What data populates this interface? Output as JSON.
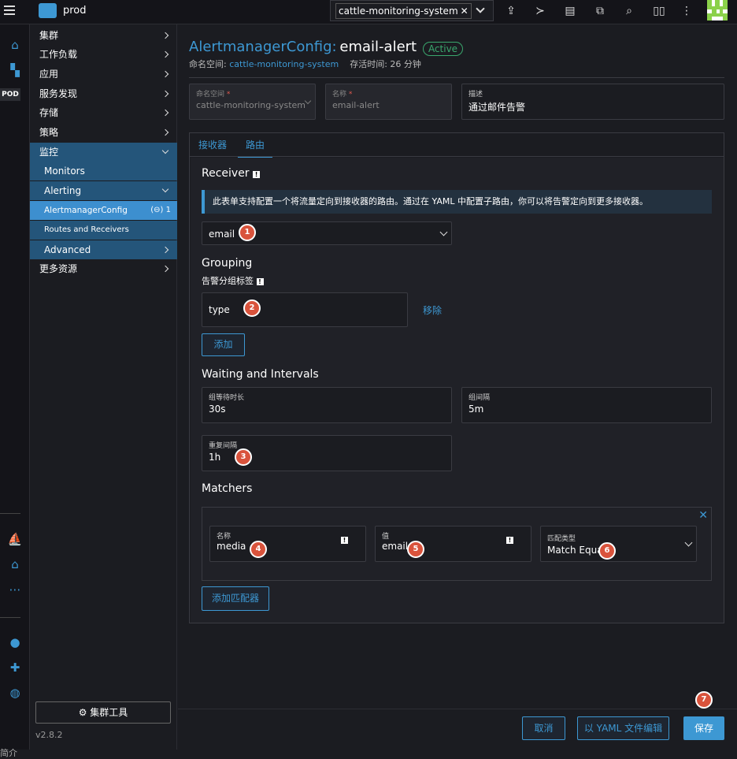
{
  "topbar": {
    "cluster_name": "prod",
    "namespace_chip": "cattle-monitoring-system",
    "chip_remove": "✕",
    "icons": [
      "upload-icon",
      "terminal-icon",
      "file-icon",
      "copy-icon",
      "search-icon",
      "book-icon",
      "more-icon"
    ]
  },
  "rail": {
    "pod_label": "POD",
    "bottom_text": "简介"
  },
  "sidenav": {
    "items": [
      {
        "label": "集群"
      },
      {
        "label": "工作负载"
      },
      {
        "label": "应用"
      },
      {
        "label": "服务发现"
      },
      {
        "label": "存储"
      },
      {
        "label": "策略"
      },
      {
        "label": "监控"
      },
      {
        "label": "Monitors"
      },
      {
        "label": "Alerting"
      },
      {
        "label": "AlertmanagerConfig",
        "count": "(⊖) 1"
      },
      {
        "label": "Routes and Receivers"
      },
      {
        "label": "Advanced"
      },
      {
        "label": "更多资源"
      }
    ],
    "tools_button": "⚙ 集群工具",
    "version": "v2.8.2"
  },
  "header": {
    "title_prefix": "AlertmanagerConfig:",
    "title_name": "email-alert",
    "status": "Active",
    "ns_label": "命名空间:",
    "ns_value": "cattle-monitoring-system",
    "age_label": "存活时间: 26 分钟"
  },
  "form": {
    "namespace": {
      "label": "命名空间",
      "required": "*",
      "value": "cattle-monitoring-system"
    },
    "name": {
      "label": "名称",
      "required": "*",
      "placeholder": "email-alert"
    },
    "description": {
      "label": "描述",
      "value": "通过邮件告警"
    }
  },
  "tabs": [
    {
      "label": "接收器"
    },
    {
      "label": "路由"
    }
  ],
  "route": {
    "receiver_heading": "Receiver",
    "info_text": "此表单支持配置一个将流量定向到接收器的路由。通过在 YAML 中配置子路由，你可以将告警定向到更多接收器。",
    "receiver_value": "email",
    "grouping_heading": "Grouping",
    "group_label_title": "告警分组标签",
    "group_value": "type",
    "remove_link": "移除",
    "add_button": "添加",
    "waiting_heading": "Waiting and Intervals",
    "group_wait": {
      "label": "组等待时长",
      "value": "30s"
    },
    "group_interval": {
      "label": "组间隔",
      "value": "5m"
    },
    "repeat_interval": {
      "label": "重复间隔",
      "value": "1h"
    },
    "matchers_heading": "Matchers",
    "matcher": {
      "name_label": "名称",
      "name_value": "media",
      "value_label": "值",
      "value_value": "email",
      "type_label": "匹配类型",
      "type_value": "Match Equal"
    },
    "add_matcher_button": "添加匹配器"
  },
  "markers": [
    "1",
    "2",
    "3",
    "4",
    "5",
    "6",
    "7"
  ],
  "footer": {
    "cancel": "取消",
    "edit_yaml": "以 YAML 文件编辑",
    "save": "保存"
  }
}
